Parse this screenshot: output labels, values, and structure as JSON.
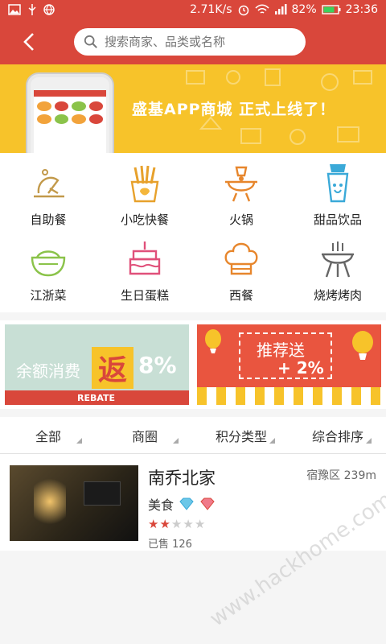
{
  "status_bar": {
    "speed": "2.71K/s",
    "battery": "82%",
    "time": "23:36"
  },
  "search": {
    "placeholder": "搜索商家、品类或名称"
  },
  "banner": {
    "title": "盛基APP商城  正式上线了！"
  },
  "categories": [
    {
      "label": "自助餐",
      "icon": "buffet-dish-icon"
    },
    {
      "label": "小吃快餐",
      "icon": "fries-icon"
    },
    {
      "label": "火锅",
      "icon": "hotpot-icon"
    },
    {
      "label": "甜品饮品",
      "icon": "drink-cup-icon"
    },
    {
      "label": "江浙菜",
      "icon": "bowl-icon"
    },
    {
      "label": "生日蛋糕",
      "icon": "cake-icon"
    },
    {
      "label": "西餐",
      "icon": "chef-hat-icon"
    },
    {
      "label": "烧烤烤肉",
      "icon": "grill-icon"
    }
  ],
  "promos": {
    "left": {
      "text": "余额消费",
      "highlight": "返",
      "percent": "8%",
      "en": "REBATE"
    },
    "right": {
      "text": "推荐送",
      "percent": "+ 2%"
    }
  },
  "filters": [
    "全部",
    "商圈",
    "积分类型",
    "综合排序"
  ],
  "stores": [
    {
      "name": "南乔北家",
      "distance": "宿豫区 239m",
      "category": "美食",
      "rating": 2,
      "rating_max": 5,
      "sold": "已售 126"
    }
  ],
  "colors": {
    "primary": "#d9473b",
    "banner": "#f7c32a",
    "icon_orange": "#e7862c",
    "icon_green": "#8bc34a",
    "icon_blue": "#3aa9d8",
    "icon_pink": "#e0507a"
  },
  "watermark": "www.hackhome.com"
}
